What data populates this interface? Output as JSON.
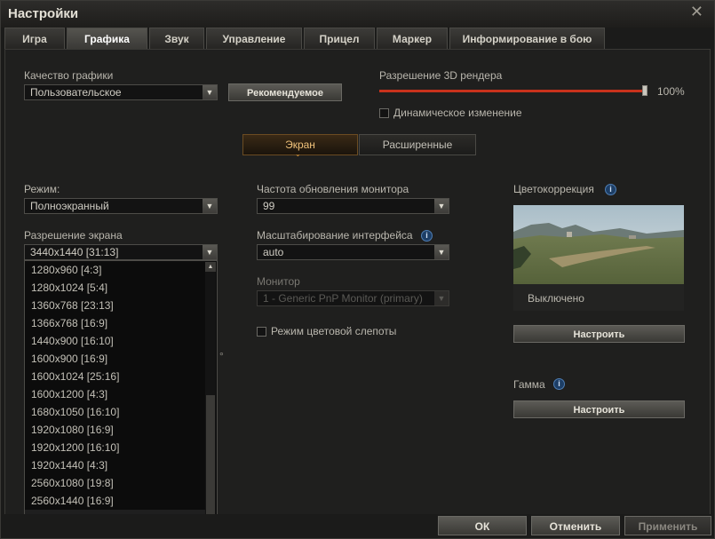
{
  "window": {
    "title": "Настройки",
    "close_glyph": "✕"
  },
  "tabs": [
    "Игра",
    "Графика",
    "Звук",
    "Управление",
    "Прицел",
    "Маркер",
    "Информирование в бою"
  ],
  "active_tab": "Графика",
  "quality": {
    "label": "Качество графики",
    "value": "Пользовательское",
    "recommended_button": "Рекомендуемое"
  },
  "render": {
    "label": "Разрешение 3D рендера",
    "value_text": "100%",
    "value": 1.0,
    "dynamic_label": "Динамическое изменение",
    "dynamic_checked": false
  },
  "subtabs": [
    "Экран",
    "Расширенные"
  ],
  "active_subtab": "Экран",
  "mode": {
    "label": "Режим:",
    "value": "Полноэкранный"
  },
  "resolution": {
    "label": "Разрешение экрана",
    "value": "3440x1440 [31:13]",
    "options": [
      "1280x960 [4:3]",
      "1280x1024 [5:4]",
      "1360x768 [23:13]",
      "1366x768 [16:9]",
      "1440x900 [16:10]",
      "1600x900 [16:9]",
      "1600x1024 [25:16]",
      "1600x1200 [4:3]",
      "1680x1050 [16:10]",
      "1920x1080 [16:9]",
      "1920x1200 [16:10]",
      "1920x1440 [4:3]",
      "2560x1080 [19:8]",
      "2560x1440 [16:9]",
      "3440x1440 [31:13]"
    ],
    "selected_index": 14,
    "partial_hidden_text": "°"
  },
  "refresh": {
    "label": "Частота обновления монитора",
    "value": "99"
  },
  "ui_scale": {
    "label": "Масштабирование интерфейса",
    "value": "auto"
  },
  "monitor": {
    "label": "Монитор",
    "value": "1 - Generic PnP Monitor (primary)"
  },
  "colorblind": {
    "label": "Режим цветовой слепоты",
    "checked": false
  },
  "color_correction": {
    "label": "Цветокоррекция",
    "status": "Выключено",
    "button": "Настроить"
  },
  "gamma": {
    "label": "Гамма",
    "button": "Настроить"
  },
  "footer": {
    "ok": "ОК",
    "cancel": "Отменить",
    "apply": "Применить"
  },
  "colors": {
    "accent": "#e09a3c",
    "slider": "#c8321c",
    "info": "#4f7fb5"
  }
}
